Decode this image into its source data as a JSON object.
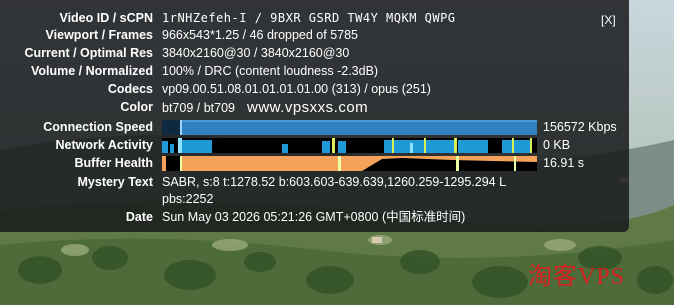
{
  "stats": {
    "close_label": "[X]",
    "rows": [
      {
        "label": "Video ID / sCPN",
        "value": "1rNHZefeh-I / 9BXR GSRD TW4Y MQKM QWPG"
      },
      {
        "label": "Viewport / Frames",
        "value": "966x543*1.25 / 46 dropped of 5785"
      },
      {
        "label": "Current / Optimal Res",
        "value": "3840x2160@30 / 3840x2160@30"
      },
      {
        "label": "Volume / Normalized",
        "value": "100% / DRC (content loudness -2.3dB)"
      },
      {
        "label": "Codecs",
        "value": "vp09.00.51.08.01.01.01.01.00 (313) / opus (251)"
      },
      {
        "label": "Color",
        "value": "bt709 / bt709",
        "extra": "www.vpsxxs.com"
      }
    ],
    "graphs": [
      {
        "label": "Connection Speed",
        "value": "156572 Kbps",
        "color": "#2f7fc1"
      },
      {
        "label": "Network Activity",
        "value": "0 KB",
        "color": "#1f9ad6"
      },
      {
        "label": "Buffer Health",
        "value": "16.91 s",
        "color": "#f6a15a"
      }
    ],
    "mystery": {
      "label": "Mystery Text",
      "line1": "SABR, s:8 t:1278.52 b:603.603-639.639,1260.259-1295.294 L",
      "line2": "pbs:2252"
    },
    "date": {
      "label": "Date",
      "value": "Sun May 03 2026 05:21:26 GMT+0800 (中国标准时间)"
    }
  },
  "watermark": "淘客VPS"
}
